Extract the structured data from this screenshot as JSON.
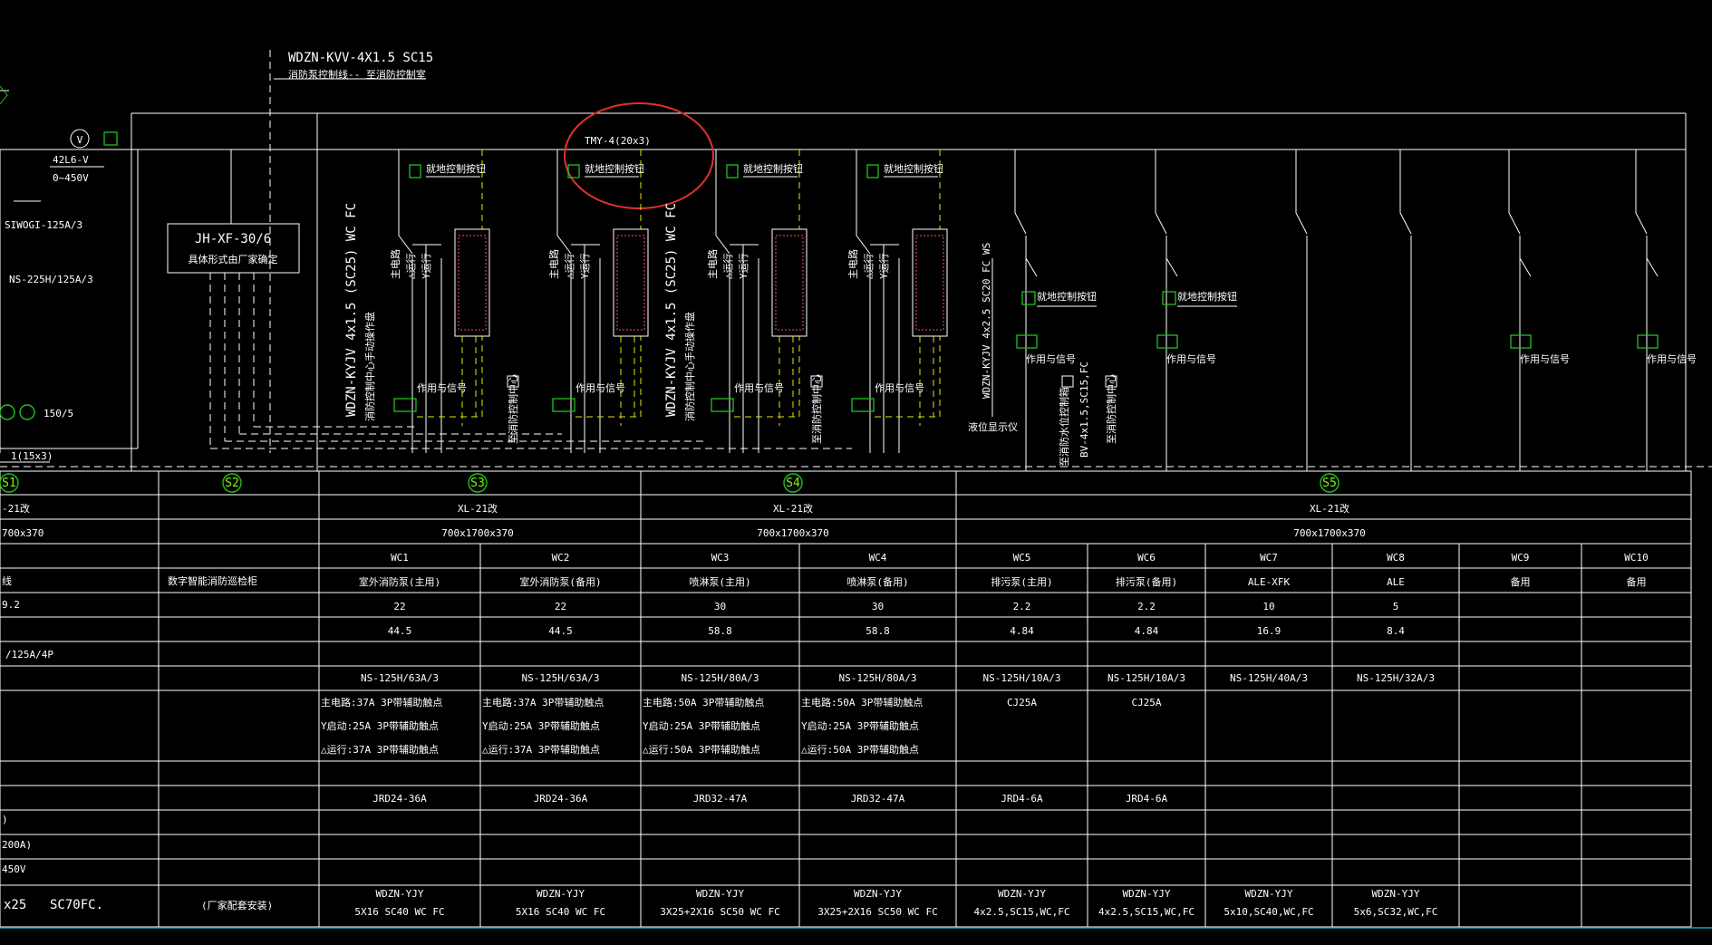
{
  "header": {
    "feeder_cable": "WDZN-KVV-4X1.5  SC15",
    "feeder_desc": "消防泵控制线-- 至消防控制室",
    "busbar_label": "TMY-4(20x3)",
    "voltmeter": "42L6-V",
    "voltmeter_range": "0~450V",
    "voltmeter_symbol": "V",
    "switch_main": "SIWOGI-125A/3",
    "breaker_main": "NS-225H/125A/3",
    "ct_ratio": "150/5",
    "left_busbar": "1(15x3)",
    "xf_box_line1": "JH-XF-30/6",
    "xf_box_line2": "具体形式由厂家确定",
    "cable_s3": "WDZN-KYJV 4x1.5 (SC25) WC FC",
    "cable_s4": "WDZN-KYJV 4x1.5 (SC25) WC FC",
    "desc_s3": "消防控制中心手动操作盘",
    "desc_s4": "消防控制中心手动操作盘",
    "remote_labels": [
      "就地控制按钮",
      "就地控制按钮",
      "就地控制按钮",
      "就地控制按钮",
      "就地控制按钮",
      "就地控制按钮"
    ],
    "signal_labels": [
      "作用与信号",
      "作用与信号",
      "作用与信号",
      "作用与信号",
      "作用与信号",
      "作用与信号",
      "作用与信号",
      "作用与信号"
    ],
    "contactor_labels": [
      "主电路",
      "△运行",
      "Y运行"
    ],
    "control_center_labels": [
      "至消防控制中心",
      "至消防控制中心",
      "至消防控制中心"
    ],
    "level_gauge": "液位显示仪",
    "cable_s5": "BV-4x1.5,SC15,FC",
    "cable_s5b": "WDZN-KYJV 4x2.5 SC20 FC WS",
    "level_ctrl": "至消防水位控制箱"
  },
  "sections": [
    {
      "id": "S1"
    },
    {
      "id": "S2"
    },
    {
      "id": "S3",
      "type": "XL-21改",
      "size": "700x1700x370"
    },
    {
      "id": "S4",
      "type": "XL-21改",
      "size": "700x1700x370"
    },
    {
      "id": "S5",
      "type": "XL-21改",
      "size": "700x1700x370"
    }
  ],
  "left_cells": {
    "type": "-21改",
    "size": "700x370",
    "row3": "线",
    "row4": "9.2",
    "row5": "",
    "row6": "/125A/4P",
    "row12": ")",
    "row13": "200A)",
    "row14": "450V",
    "row15a": "x25",
    "row15b": "SC70FC."
  },
  "s2_cells": {
    "name": "数字智能消防巡检柜",
    "install": "(厂家配套安装)"
  },
  "circuits": [
    {
      "id": "WC1",
      "name": "室外消防泵(主用)",
      "power": "22",
      "current": "44.5",
      "breaker": "NS-125H/63A/3",
      "contactor": [
        "主电路:37A 3P带辅助触点",
        "Y启动:25A  3P带辅助触点",
        "△运行:37A 3P带辅助触点"
      ],
      "relay": "JRD24-36A",
      "cable": [
        "WDZN-YJY",
        "5X16  SC40  WC FC"
      ]
    },
    {
      "id": "WC2",
      "name": "室外消防泵(备用)",
      "power": "22",
      "current": "44.5",
      "breaker": "NS-125H/63A/3",
      "contactor": [
        "主电路:37A 3P带辅助触点",
        "Y启动:25A  3P带辅助触点",
        "△运行:37A 3P带辅助触点"
      ],
      "relay": "JRD24-36A",
      "cable": [
        "WDZN-YJY",
        "5X16  SC40  WC FC"
      ]
    },
    {
      "id": "WC3",
      "name": "喷淋泵(主用)",
      "power": "30",
      "current": "58.8",
      "breaker": "NS-125H/80A/3",
      "contactor": [
        "主电路:50A 3P带辅助触点",
        "Y启动:25A  3P带辅助触点",
        "△运行:50A 3P带辅助触点"
      ],
      "relay": "JRD32-47A",
      "cable": [
        "WDZN-YJY",
        "3X25+2X16  SC50  WC FC"
      ]
    },
    {
      "id": "WC4",
      "name": "喷淋泵(备用)",
      "power": "30",
      "current": "58.8",
      "breaker": "NS-125H/80A/3",
      "contactor": [
        "主电路:50A 3P带辅助触点",
        "Y启动:25A  3P带辅助触点",
        "△运行:50A 3P带辅助触点"
      ],
      "relay": "JRD32-47A",
      "cable": [
        "WDZN-YJY",
        "3X25+2X16  SC50  WC FC"
      ]
    },
    {
      "id": "WC5",
      "name": "排污泵(主用)",
      "power": "2.2",
      "current": "4.84",
      "breaker": "NS-125H/10A/3",
      "contactor": [
        "CJ25A"
      ],
      "relay": "JRD4-6A",
      "cable": [
        "WDZN-YJY",
        "4x2.5,SC15,WC,FC"
      ]
    },
    {
      "id": "WC6",
      "name": "排污泵(备用)",
      "power": "2.2",
      "current": "4.84",
      "breaker": "NS-125H/10A/3",
      "contactor": [
        "CJ25A"
      ],
      "relay": "JRD4-6A",
      "cable": [
        "WDZN-YJY",
        "4x2.5,SC15,WC,FC"
      ]
    },
    {
      "id": "WC7",
      "name": "ALE-XFK",
      "power": "10",
      "current": "16.9",
      "breaker": "NS-125H/40A/3",
      "contactor": [],
      "relay": "",
      "cable": [
        "WDZN-YJY",
        "5x10,SC40,WC,FC"
      ]
    },
    {
      "id": "WC8",
      "name": "ALE",
      "power": "5",
      "current": "8.4",
      "breaker": "NS-125H/32A/3",
      "contactor": [],
      "relay": "",
      "cable": [
        "WDZN-YJY",
        "5x6,SC32,WC,FC"
      ]
    },
    {
      "id": "WC9",
      "name": "备用",
      "power": "",
      "current": "",
      "breaker": "",
      "contactor": [],
      "relay": "",
      "cable": []
    },
    {
      "id": "WC10",
      "name": "备用",
      "power": "",
      "current": "",
      "breaker": "",
      "contactor": [],
      "relay": "",
      "cable": []
    }
  ],
  "colors": {
    "background": "#000000",
    "line": "#ffffff",
    "control_wire": "#e6e600",
    "terminal": "#22c022",
    "markup_circle": "#e03030",
    "pump_box_text": "#ff4d6d",
    "bottom_border": "#00b4c8"
  }
}
